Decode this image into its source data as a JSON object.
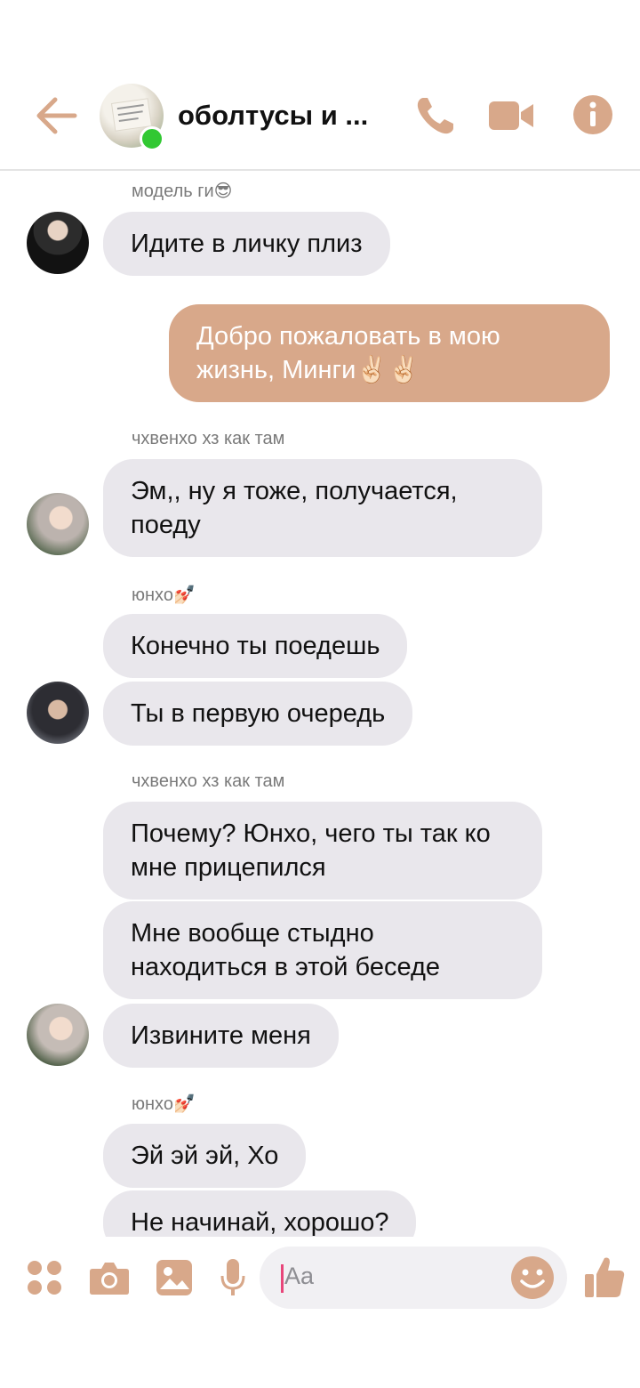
{
  "header": {
    "title": "оболтусы и ...",
    "accent_color": "#d8a88a",
    "online_color": "#31c832"
  },
  "messages": [
    {
      "type": "sender",
      "text": "модель ги😎"
    },
    {
      "type": "in",
      "text": "Идите в личку плиз"
    },
    {
      "type": "out",
      "text": "Добро пожаловать в мою жизнь, Минги✌🏻✌🏻"
    },
    {
      "type": "sender",
      "text": "чхвенхо хз как там"
    },
    {
      "type": "in",
      "text": "Эм,, ну я тоже, получается, поеду"
    },
    {
      "type": "sender",
      "text": "юнхо💅🏻"
    },
    {
      "type": "in",
      "text": "Конечно ты поедешь"
    },
    {
      "type": "in",
      "text": "Ты в первую очередь"
    },
    {
      "type": "sender",
      "text": "чхвенхо хз как там"
    },
    {
      "type": "in",
      "text": "Почему? Юнхо, чего ты так ко мне прицепился"
    },
    {
      "type": "in",
      "text": "Мне вообще стыдно находиться в этой беседе"
    },
    {
      "type": "in",
      "text": "Извините меня"
    },
    {
      "type": "sender",
      "text": "юнхо💅🏻"
    },
    {
      "type": "in",
      "text": "Эй эй эй, Хо"
    },
    {
      "type": "in",
      "text": "Не начинай, хорошо?"
    }
  ],
  "composer": {
    "placeholder": "Aa"
  },
  "icons": [
    "back-arrow-icon",
    "phone-icon",
    "video-camera-icon",
    "info-icon",
    "apps-icon",
    "camera-icon",
    "gallery-icon",
    "microphone-icon",
    "emoji-icon",
    "thumbs-up-icon"
  ]
}
